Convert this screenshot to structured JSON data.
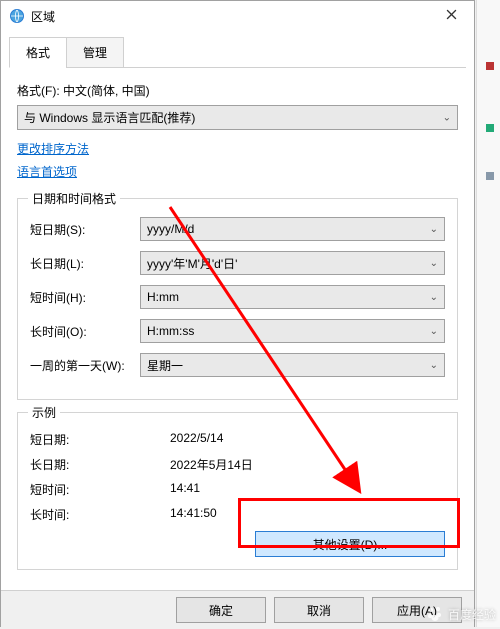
{
  "window": {
    "title": "区域"
  },
  "tabs": {
    "format": "格式",
    "admin": "管理"
  },
  "format": {
    "label": "格式(F): 中文(简体, 中国)",
    "dropdown_value": "与 Windows 显示语言匹配(推荐)"
  },
  "links": {
    "change_sort": "更改排序方法",
    "lang_prefs": "语言首选项"
  },
  "datetime_group": {
    "legend": "日期和时间格式",
    "rows": {
      "short_date": {
        "label": "短日期(S):",
        "value": "yyyy/M/d"
      },
      "long_date": {
        "label": "长日期(L):",
        "value": "yyyy'年'M'月'd'日'"
      },
      "short_time": {
        "label": "短时间(H):",
        "value": "H:mm"
      },
      "long_time": {
        "label": "长时间(O):",
        "value": "H:mm:ss"
      },
      "first_day": {
        "label": "一周的第一天(W):",
        "value": "星期一"
      }
    }
  },
  "example_group": {
    "legend": "示例",
    "rows": {
      "short_date": {
        "label": "短日期:",
        "value": "2022/5/14"
      },
      "long_date": {
        "label": "长日期:",
        "value": "2022年5月14日"
      },
      "short_time": {
        "label": "短时间:",
        "value": "14:41"
      },
      "long_time": {
        "label": "长时间:",
        "value": "14:41:50"
      }
    }
  },
  "buttons": {
    "additional": "其他设置(D)...",
    "ok": "确定",
    "cancel": "取消",
    "apply": "应用(A)"
  },
  "watermark": {
    "text": "百度经验"
  }
}
